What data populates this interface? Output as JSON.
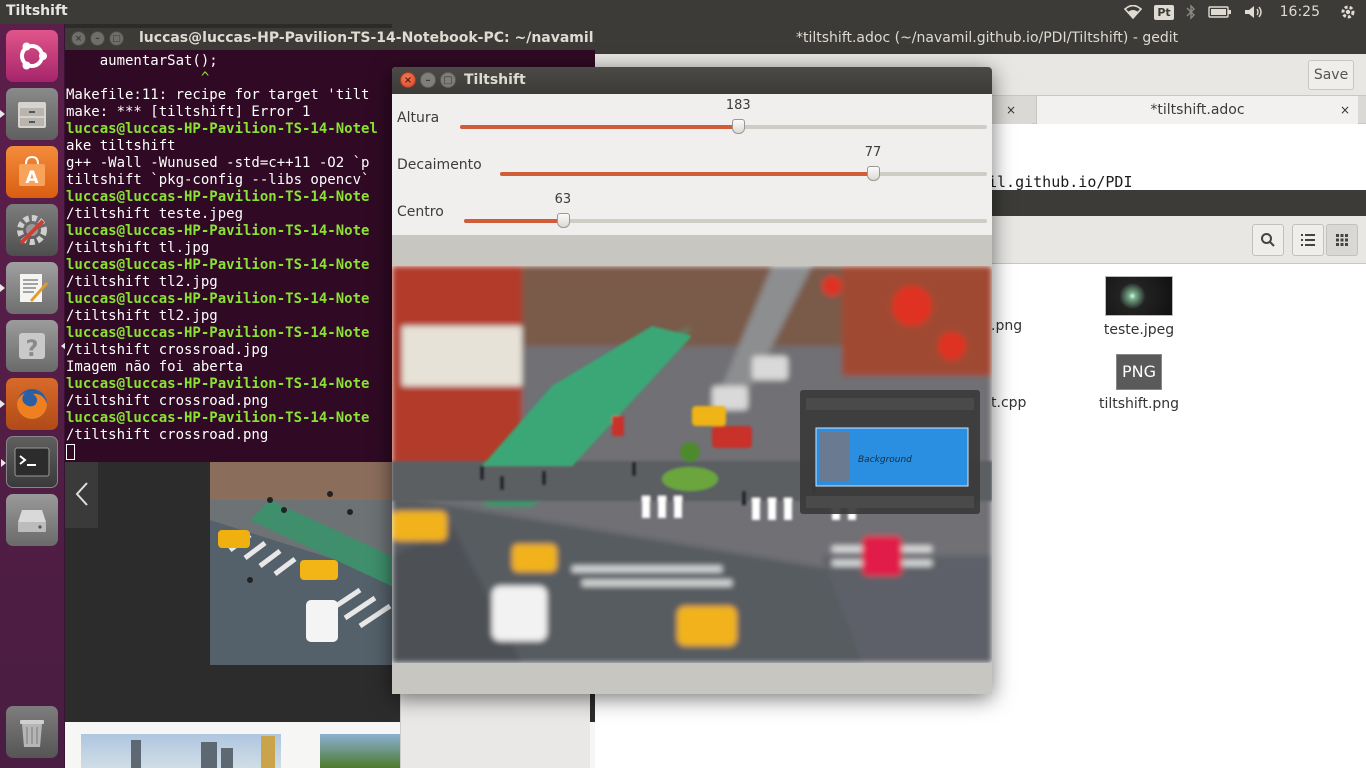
{
  "top_panel": {
    "app_name": "Tiltshift",
    "keyboard_layout": "Pt",
    "clock": "16:25"
  },
  "launcher": {
    "items": [
      "ubuntu-dash",
      "files",
      "software-center",
      "system-settings",
      "text-editor",
      "help",
      "firefox",
      "terminal",
      "disks",
      "trash"
    ]
  },
  "gedit": {
    "title": "*tiltshift.adoc (~/navamil.github.io/PDI/Tiltshift) - gedit",
    "save_label": "Save",
    "tabs": [
      {
        "label": "",
        "close": "×"
      },
      {
        "label": "*tiltshift.adoc",
        "close": "×"
      }
    ],
    "visible_text": "il.github.io/PDI"
  },
  "nautilus": {
    "files": [
      {
        "name": "teste.jpeg"
      },
      {
        "name": "tiltshift.png",
        "icon_text": "PNG"
      }
    ],
    "partial_names": [
      ".png",
      "t.cpp"
    ]
  },
  "terminal": {
    "title": "luccas@luccas-HP-Pavilion-TS-14-Notebook-PC: ~/navamil.github.io/PDI/Tiltshift",
    "lines": [
      {
        "text": "    aumentarSat();",
        "kind": "normal"
      },
      {
        "text": "                ^",
        "kind": "caret"
      },
      {
        "text": "Makefile:11: recipe for target 'tilt",
        "kind": "normal"
      },
      {
        "text": "make: *** [tiltshift] Error 1",
        "kind": "normal"
      },
      {
        "text": "luccas@luccas-HP-Pavilion-TS-14-Notel",
        "kind": "prompt"
      },
      {
        "text": "ake tiltshift",
        "kind": "normal"
      },
      {
        "text": "g++ -Wall -Wunused -std=c++11 -O2 `p",
        "kind": "normal"
      },
      {
        "text": "tiltshift `pkg-config --libs opencv`",
        "kind": "normal"
      },
      {
        "text": "luccas@luccas-HP-Pavilion-TS-14-Note",
        "kind": "prompt"
      },
      {
        "text": "/tiltshift teste.jpeg",
        "kind": "normal"
      },
      {
        "text": "luccas@luccas-HP-Pavilion-TS-14-Note",
        "kind": "prompt"
      },
      {
        "text": "/tiltshift tl.jpg",
        "kind": "normal"
      },
      {
        "text": "luccas@luccas-HP-Pavilion-TS-14-Note",
        "kind": "prompt"
      },
      {
        "text": "/tiltshift tl2.jpg",
        "kind": "normal"
      },
      {
        "text": "luccas@luccas-HP-Pavilion-TS-14-Note",
        "kind": "prompt"
      },
      {
        "text": "/tiltshift tl2.jpg",
        "kind": "normal"
      },
      {
        "text": "luccas@luccas-HP-Pavilion-TS-14-Note",
        "kind": "prompt"
      },
      {
        "text": "/tiltshift crossroad.jpg",
        "kind": "normal"
      },
      {
        "text": "Imagem não foi aberta",
        "kind": "normal"
      },
      {
        "text": "luccas@luccas-HP-Pavilion-TS-14-Note",
        "kind": "prompt"
      },
      {
        "text": "/tiltshift crossroad.png",
        "kind": "normal"
      },
      {
        "text": "luccas@luccas-HP-Pavilion-TS-14-Note",
        "kind": "prompt"
      },
      {
        "text": "/tiltshift crossroad.png",
        "kind": "normal"
      }
    ]
  },
  "tiltshift": {
    "title": "Tiltshift",
    "sliders": [
      {
        "label": "Altura",
        "value": "183",
        "fraction": 0.528
      },
      {
        "label": "Decaimento",
        "value": "77",
        "fraction": 0.766
      },
      {
        "label": "Centro",
        "value": "63",
        "fraction": 0.189
      }
    ],
    "overlay_panel_text": "Background"
  },
  "colors": {
    "accent": "#d05d38",
    "terminal_bg": "#300a24",
    "prompt_green": "#8ae234",
    "panel": "#3c3b37"
  }
}
